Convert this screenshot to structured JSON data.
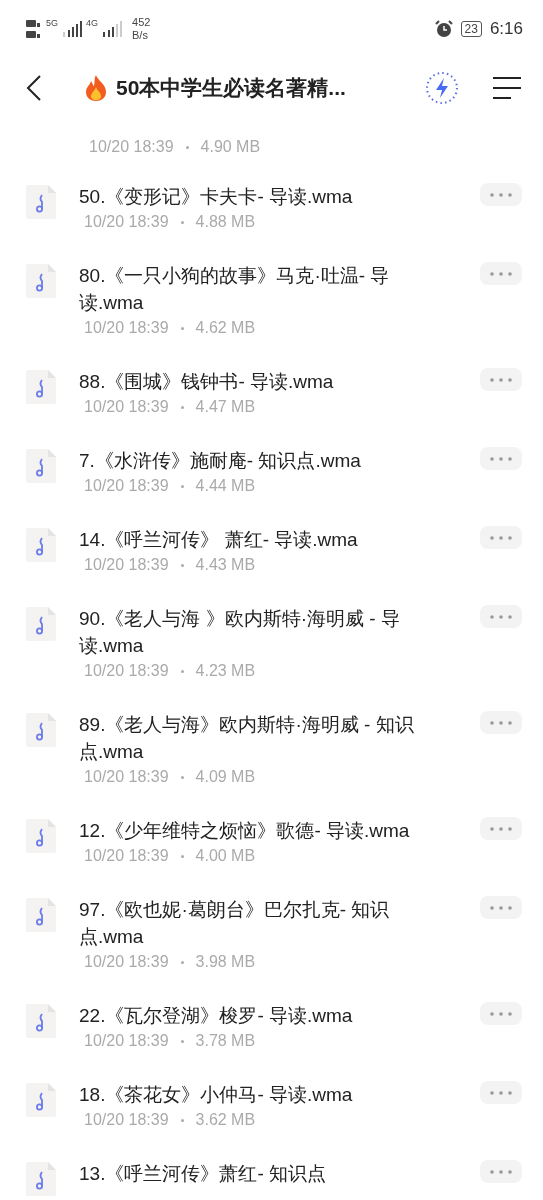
{
  "status_bar": {
    "network_1": "5G",
    "network_2": "4G",
    "speed_value": "452",
    "speed_unit": "B/s",
    "battery": "23",
    "time": "6:16"
  },
  "header": {
    "title": "50本中学生必读名著精..."
  },
  "partial_item": {
    "meta_date": "10/20 18:39",
    "meta_size": "4.90 MB"
  },
  "files": [
    {
      "name": "50.《变形记》卡夫卡- 导读.wma",
      "date": "10/20 18:39",
      "size": "4.88 MB"
    },
    {
      "name": "80.《一只小狗的故事》马克·吐温- 导读.wma",
      "date": "10/20 18:39",
      "size": "4.62 MB"
    },
    {
      "name": "88.《围城》钱钟书- 导读.wma",
      "date": "10/20 18:39",
      "size": "4.47 MB"
    },
    {
      "name": "7.《水浒传》施耐庵- 知识点.wma",
      "date": "10/20 18:39",
      "size": "4.44 MB"
    },
    {
      "name": "14.《呼兰河传》 萧红- 导读.wma",
      "date": "10/20 18:39",
      "size": "4.43 MB"
    },
    {
      "name": "90.《老人与海 》欧内斯特·海明威 - 导读.wma",
      "date": "10/20 18:39",
      "size": "4.23 MB"
    },
    {
      "name": "89.《老人与海》欧内斯特·海明威 - 知识点.wma",
      "date": "10/20 18:39",
      "size": "4.09 MB"
    },
    {
      "name": "12.《少年维特之烦恼》歌德- 导读.wma",
      "date": "10/20 18:39",
      "size": "4.00 MB"
    },
    {
      "name": "97.《欧也妮·葛朗台》巴尔扎克- 知识点.wma",
      "date": "10/20 18:39",
      "size": "3.98 MB"
    },
    {
      "name": "22.《瓦尔登湖》梭罗- 导读.wma",
      "date": "10/20 18:39",
      "size": "3.78 MB"
    },
    {
      "name": "18.《茶花女》小仲马- 导读.wma",
      "date": "10/20 18:39",
      "size": "3.62 MB"
    },
    {
      "name": "13.《呼兰河传》萧红- 知识点"
    }
  ]
}
